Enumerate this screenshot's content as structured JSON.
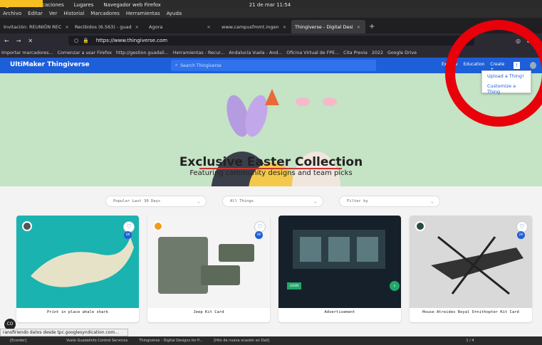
{
  "system": {
    "apps": "Aplicaciones",
    "places": "Lugares",
    "browser": "Navegador web Firefox",
    "clock": "21 de mar  11:54"
  },
  "menu": [
    "Archivo",
    "Editar",
    "Ver",
    "Historial",
    "Marcadores",
    "Herramientas",
    "Ayuda"
  ],
  "tabs": [
    {
      "label": "Invitación: REUNIÓN REC"
    },
    {
      "label": "Recibidos (6.563) - guad"
    },
    {
      "label": "Agora"
    },
    {
      "label": "www.campusfmmt.ingen"
    },
    {
      "label": "Thingiverse - Digital Desi"
    }
  ],
  "url": "https://www.thingiverse.com",
  "bookmarks": [
    "Importar marcadores...",
    "Comenzar a usar Firefox",
    "http://gestion.guadali...",
    "Herramientas - Recur...",
    "Andalucía Vuela - And...",
    "Oficina Virtual de FPE...",
    "Cita Previa",
    "2022",
    "Google Drive"
  ],
  "site": {
    "logo": "UltiMaker Thingiverse",
    "search_placeholder": "Search Thingiverse",
    "nav": [
      "Explore",
      "Education",
      "Create +"
    ]
  },
  "dropdown": [
    "Upload a Thing!",
    "Customize a Thing"
  ],
  "hero": {
    "title": "Exclusive Easter Collection",
    "subtitle": "Featuring community designs and team picks"
  },
  "filters": [
    "Popular Last 30 Days",
    "All Things",
    "Filter by"
  ],
  "cards": [
    {
      "caption": "Print in place whale shark",
      "likes": "4K"
    },
    {
      "caption": "Jeep Kit Card",
      "likes": "4K"
    },
    {
      "caption": "Advertisement",
      "likes": ""
    },
    {
      "caption": "House Atreides Royal Ornithopter Kit Card",
      "likes": "2K"
    }
  ],
  "ad": {
    "cta": "LOGIN"
  },
  "status": "ransfiriendo datos desde tpc.googlesyndication.com...",
  "taskbar": [
    "[Ecorder]",
    "Vuelo Guadalinfo Control Servicios",
    "Thingiverse - Digital Designs for P...",
    "[Hilo de nueva ocasión en Dali]",
    "1 / 4"
  ]
}
